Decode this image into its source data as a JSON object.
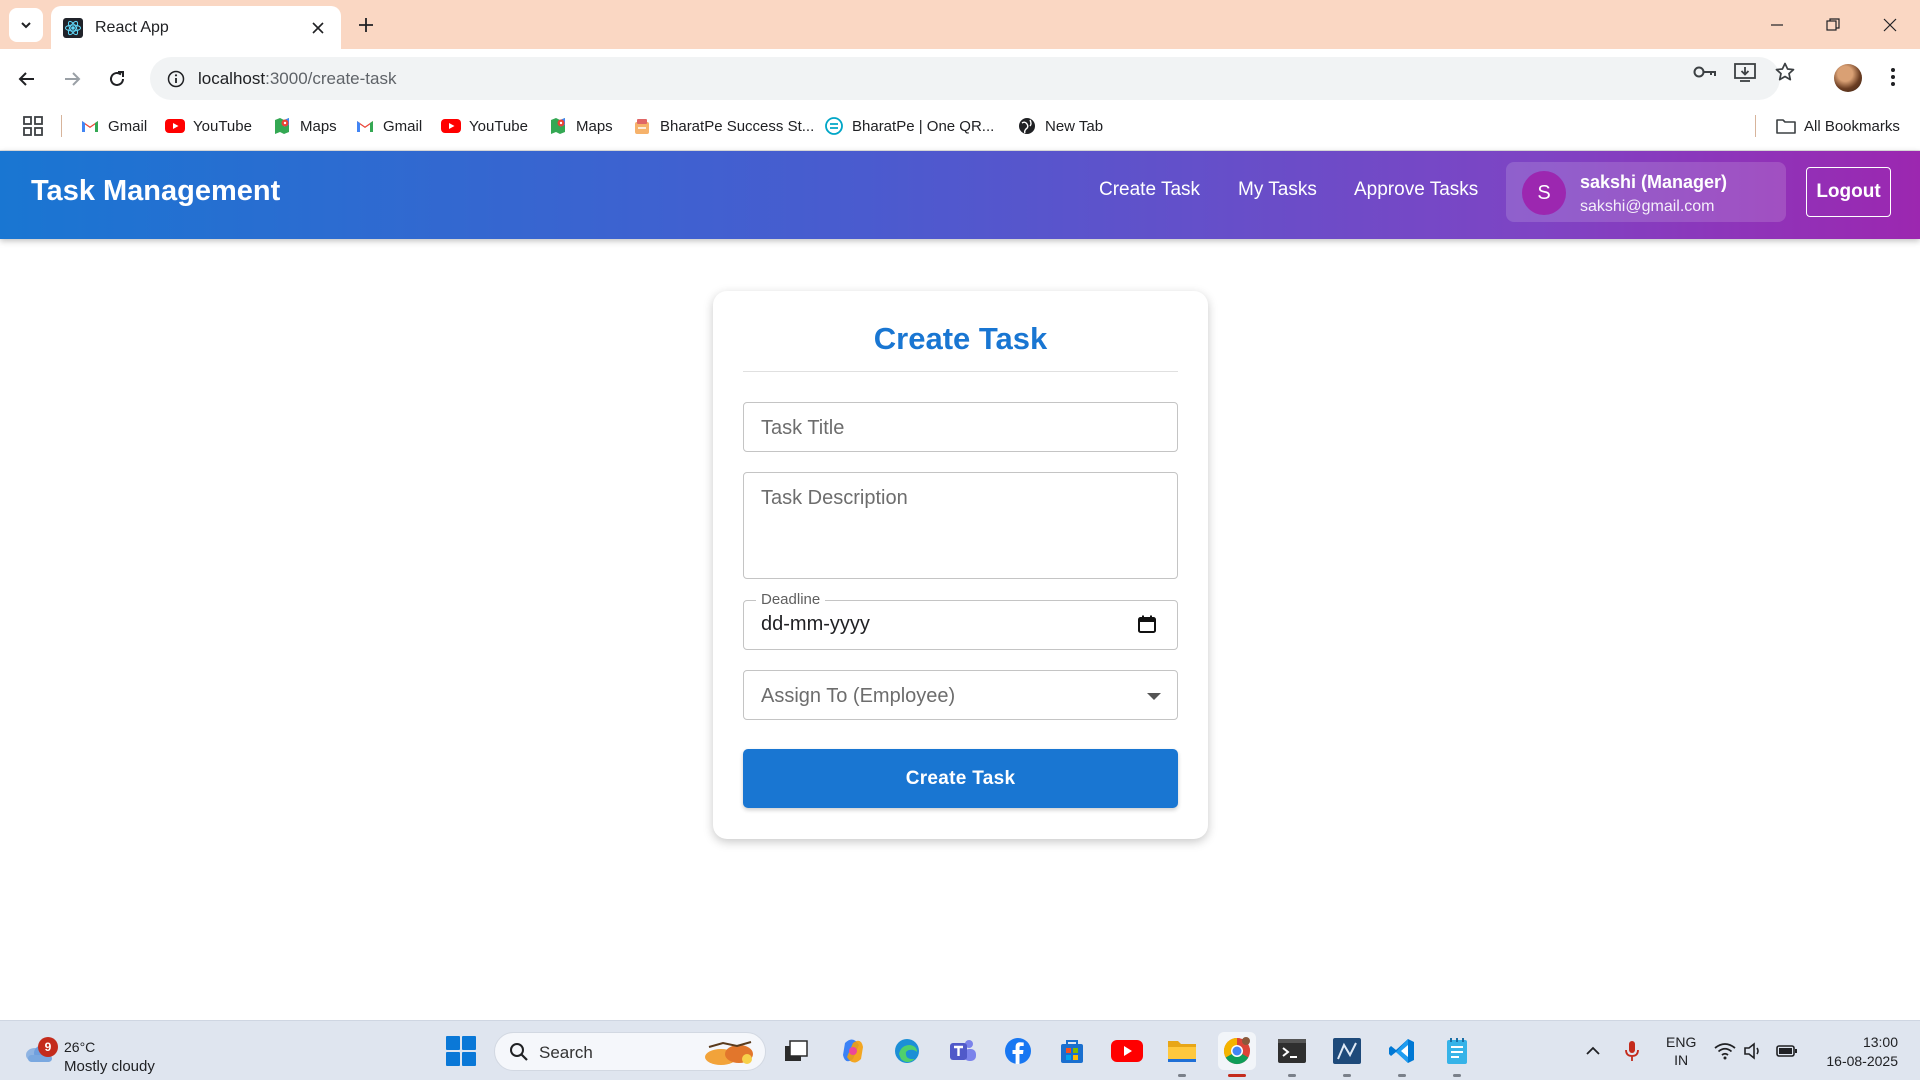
{
  "browser": {
    "tab_title": "React App",
    "url_host": "localhost",
    "url_path": ":3000/create-task",
    "bookmarks": [
      {
        "label": "Gmail",
        "icon": "gmail-icon"
      },
      {
        "label": "YouTube",
        "icon": "youtube-icon"
      },
      {
        "label": "Maps",
        "icon": "maps-icon"
      },
      {
        "label": "Gmail",
        "icon": "gmail-icon"
      },
      {
        "label": "YouTube",
        "icon": "youtube-icon"
      },
      {
        "label": "Maps",
        "icon": "maps-icon"
      },
      {
        "label": "BharatPe Success St...",
        "icon": "bharatpe-icon"
      },
      {
        "label": "BharatPe | One QR...",
        "icon": "bharatpe-qr-icon"
      },
      {
        "label": "New Tab",
        "icon": "globe-icon"
      }
    ],
    "all_bookmarks_label": "All Bookmarks"
  },
  "app": {
    "title": "Task Management",
    "nav": {
      "create_task": "Create Task",
      "my_tasks": "My Tasks",
      "approve_tasks": "Approve Tasks"
    },
    "user": {
      "initial": "S",
      "name": "sakshi (Manager)",
      "email": "sakshi@gmail.com"
    },
    "logout_label": "Logout",
    "colors": {
      "primary": "#1976d2",
      "accent": "#9c27b0"
    }
  },
  "form": {
    "heading": "Create Task",
    "title_placeholder": "Task Title",
    "description_placeholder": "Task Description",
    "deadline_label": "Deadline",
    "deadline_value": "dd-mm-yyyy",
    "assign_placeholder": "Assign To (Employee)",
    "submit_label": "Create Task"
  },
  "taskbar": {
    "weather_temp": "26°C",
    "weather_condition": "Mostly cloudy",
    "weather_badge": "9",
    "search_label": "Search",
    "lang_line1": "ENG",
    "lang_line2": "IN",
    "time": "13:00",
    "date": "16-08-2025"
  }
}
